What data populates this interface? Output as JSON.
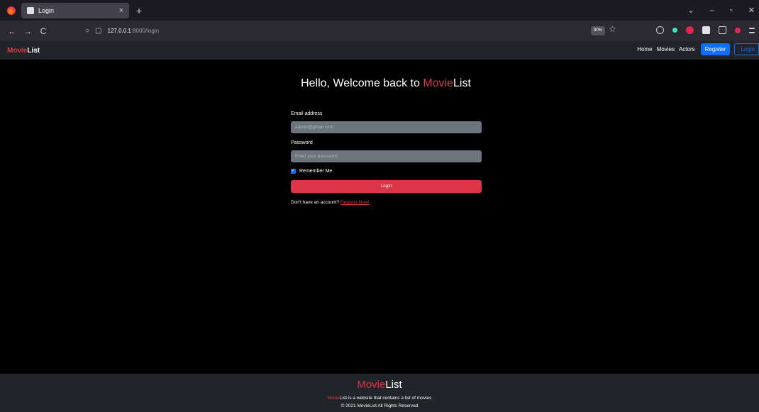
{
  "browser": {
    "tab_title": "Login",
    "tab_close": "×",
    "new_tab": "+",
    "back": "←",
    "forward": "→",
    "reload": "C",
    "url_host": "127.0.0.1",
    "url_path": ":8000/login",
    "zoom": "90%",
    "win_chevron": "⌄",
    "win_min": "–",
    "win_max": "▫",
    "win_close": "✕"
  },
  "site_nav": {
    "brand_red": "Movie",
    "brand_white": "List",
    "links": [
      "Home",
      "Movies",
      "Actors"
    ],
    "register": "Register",
    "login": "Login"
  },
  "login": {
    "heading_prefix": "Hello, Welcome back to ",
    "heading_red": "Movie",
    "heading_white": "List",
    "email_label": "Email address",
    "email_value": "admin@gmail.com",
    "password_label": "Password",
    "password_placeholder": "Enter your password",
    "remember_label": "Remember Me",
    "remember_checked": true,
    "submit": "Login",
    "no_account": "Don't have an account? ",
    "register_link": "Register Now!"
  },
  "footer": {
    "brand_red": "Movie",
    "brand_white": "List",
    "desc_red": "Movie",
    "desc_rest": "List is a website that contains a list of movies",
    "copyright": "© 2021 MovieList All Rights Reserved"
  },
  "colors": {
    "accent": "#dc3545",
    "primary": "#0d6efd",
    "navbar": "#212529"
  }
}
